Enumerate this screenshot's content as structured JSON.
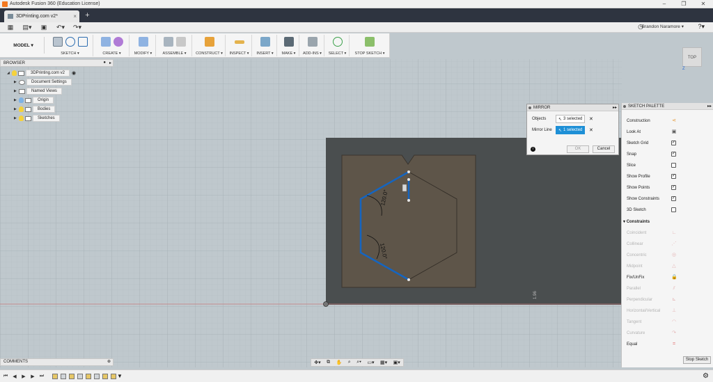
{
  "window": {
    "title": "Autodesk Fusion 360 (Education License)"
  },
  "tab": {
    "label": "3DPrinting.com v2*"
  },
  "user": {
    "name": "Brandon Naramore ▾"
  },
  "ribbon": {
    "workspace": "MODEL ▾",
    "groups": [
      {
        "label": "SKETCH ▾"
      },
      {
        "label": "CREATE ▾"
      },
      {
        "label": "MODIFY ▾"
      },
      {
        "label": "ASSEMBLE ▾"
      },
      {
        "label": "CONSTRUCT ▾"
      },
      {
        "label": "INSPECT ▾"
      },
      {
        "label": "INSERT ▾"
      },
      {
        "label": "MAKE ▾"
      },
      {
        "label": "ADD-INS ▾"
      },
      {
        "label": "SELECT ▾"
      },
      {
        "label": "STOP SKETCH ▾"
      }
    ]
  },
  "browser": {
    "title": "BROWSER",
    "root": "3DPrinting.com v2",
    "items": [
      {
        "label": "Document Settings"
      },
      {
        "label": "Named Views"
      },
      {
        "label": "Origin"
      },
      {
        "label": "Bodies"
      },
      {
        "label": "Sketches"
      }
    ]
  },
  "sketch": {
    "dim1": "120.0°",
    "dim2": "120.0°",
    "side_label": "1.96"
  },
  "mirror": {
    "title": "MIRROR",
    "objects_label": "Objects",
    "objects_value": "3 selected",
    "line_label": "Mirror Line",
    "line_value": "1 selected",
    "ok": "OK",
    "cancel": "Cancel"
  },
  "palette": {
    "title": "SKETCH PALETTE",
    "options": [
      {
        "label": "Construction",
        "control": "icon",
        "icon": "construction-icon"
      },
      {
        "label": "Look At",
        "control": "icon",
        "icon": "look-at-icon"
      },
      {
        "label": "Sketch Grid",
        "control": "checkbox",
        "checked": true
      },
      {
        "label": "Snap",
        "control": "checkbox",
        "checked": true
      },
      {
        "label": "Slice",
        "control": "checkbox",
        "checked": false
      },
      {
        "label": "Show Profile",
        "control": "checkbox",
        "checked": true
      },
      {
        "label": "Show Points",
        "control": "checkbox",
        "checked": true
      },
      {
        "label": "Show Constraints",
        "control": "checkbox",
        "checked": true
      },
      {
        "label": "3D Sketch",
        "control": "checkbox",
        "checked": false
      }
    ],
    "constraints_title": "Constraints",
    "constraints": [
      {
        "label": "Coincident",
        "enabled": false,
        "icon": "coincident-icon"
      },
      {
        "label": "Collinear",
        "enabled": false,
        "icon": "collinear-icon"
      },
      {
        "label": "Concentric",
        "enabled": false,
        "icon": "concentric-icon"
      },
      {
        "label": "Midpoint",
        "enabled": false,
        "icon": "midpoint-icon"
      },
      {
        "label": "Fix/UnFix",
        "enabled": true,
        "icon": "lock-icon"
      },
      {
        "label": "Parallel",
        "enabled": false,
        "icon": "parallel-icon"
      },
      {
        "label": "Perpendicular",
        "enabled": false,
        "icon": "perpendicular-icon"
      },
      {
        "label": "Horizontal/Vertical",
        "enabled": false,
        "icon": "horizontal-vertical-icon"
      },
      {
        "label": "Tangent",
        "enabled": false,
        "icon": "tangent-icon"
      },
      {
        "label": "Curvature",
        "enabled": false,
        "icon": "curvature-icon"
      },
      {
        "label": "Equal",
        "enabled": true,
        "icon": "equal-icon"
      }
    ],
    "stop_label": "Stop Sketch"
  },
  "comments": {
    "title": "COMMENTS"
  },
  "viewcube": {
    "face": "TOP",
    "axis": "Z"
  },
  "colors": {
    "accent": "#1d8fd6",
    "sketch_line": "#1565c0",
    "grid_bg": "#bfc8cd",
    "plate": "#5e5549",
    "shadow": "#4a4e4f"
  }
}
